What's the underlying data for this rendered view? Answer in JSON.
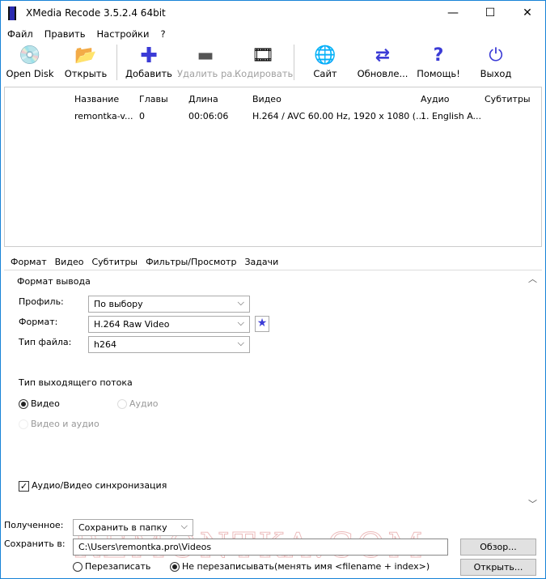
{
  "window": {
    "title": "XMedia Recode 3.5.2.4 64bit",
    "minimize": "—",
    "maximize": "☐",
    "close": "✕"
  },
  "menu": [
    "Файл",
    "Править",
    "Настройки",
    "?"
  ],
  "toolbar": [
    {
      "label": "Open Disk",
      "icon": "disc-icon",
      "glyph": "💿",
      "enabled": true
    },
    {
      "label": "Открыть",
      "icon": "open-folder-icon",
      "glyph": "📂",
      "enabled": true
    },
    {
      "label": "Добавить",
      "icon": "plus-icon",
      "glyph": "✚",
      "enabled": true
    },
    {
      "label": "Удалить ра...",
      "icon": "minus-icon",
      "glyph": "▬",
      "enabled": false
    },
    {
      "label": "Кодировать",
      "icon": "encode-icon",
      "glyph": "🎞",
      "enabled": false
    },
    {
      "label": "Сайт",
      "icon": "globe-icon",
      "glyph": "🌐",
      "enabled": true
    },
    {
      "label": "Обновле...",
      "icon": "refresh-icon",
      "glyph": "⇄",
      "enabled": true
    },
    {
      "label": "Помощь!",
      "icon": "help-icon",
      "glyph": "?",
      "enabled": true
    },
    {
      "label": "Выход",
      "icon": "power-icon",
      "glyph": "⏻",
      "enabled": true
    }
  ],
  "file_list": {
    "headers": [
      "Название",
      "Главы",
      "Длина",
      "Видео",
      "Аудио",
      "Субтитры"
    ],
    "rows": [
      [
        "remontka-v...",
        "0",
        "00:06:06",
        "H.264 / AVC  60.00 Hz, 1920 x 1080 (...",
        "1. English A...",
        ""
      ]
    ]
  },
  "tabs": [
    "Формат",
    "Видео",
    "Субтитры",
    "Фильтры/Просмотр",
    "Задачи"
  ],
  "format": {
    "section": "Формат вывода",
    "profile_label": "Профиль:",
    "profile": "По выбору",
    "format_label": "Формат:",
    "format": "H.264 Raw Video",
    "filetype_label": "Тип файла:",
    "filetype": "h264",
    "stream_label": "Тип выходящего потока",
    "opt_video": "Видео",
    "opt_audio": "Аудио",
    "opt_both": "Видео и аудио",
    "sync_label": "Аудио/Видео синхронизация",
    "sync_checked": true
  },
  "output": {
    "received_label": "Полученное:",
    "received": "Сохранить в папку",
    "save_label": "Сохранить в:",
    "path": "C:\\Users\\remontka.pro\\Videos",
    "browse": "Обзор...",
    "open": "Открыть...",
    "overwrite": "Перезаписать",
    "no_overwrite": "Не перезаписывать(менять имя <filename + index>)"
  },
  "watermark": "REMONTKA.COM",
  "colors": {
    "accent": "#3b3bd6",
    "border": "#1883d7"
  }
}
